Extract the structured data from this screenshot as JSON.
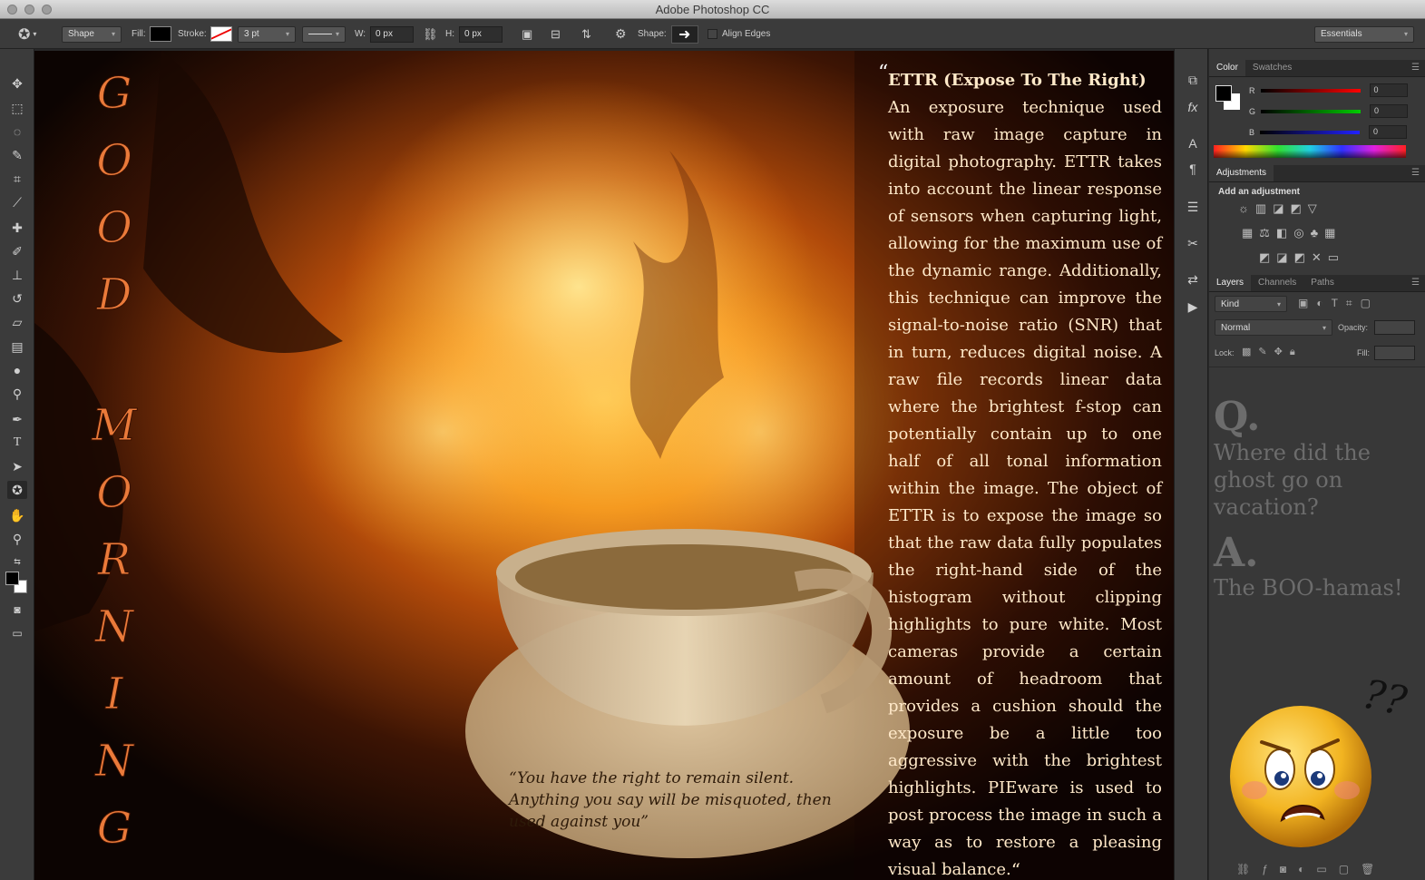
{
  "app": {
    "title": "Adobe Photoshop CC"
  },
  "options_bar": {
    "mode": "Shape",
    "fill_label": "Fill:",
    "stroke_label": "Stroke:",
    "stroke_width": "3 pt",
    "w_label": "W:",
    "w_value": "0 px",
    "h_label": "H:",
    "h_value": "0 px",
    "shape_label": "Shape:",
    "align_edges_label": "Align Edges",
    "workspace": "Essentials"
  },
  "canvas": {
    "vertical_text": [
      "G",
      "O",
      "O",
      "D",
      " ",
      "M",
      "O",
      "R",
      "N",
      "I",
      "N",
      "G"
    ],
    "article_title": "ETTR (Expose To The Right)",
    "article_body": "An exposure technique used with raw image capture in digital photography. ETTR takes into account the linear response of sensors when capturing light, allowing for the maximum use of the dynamic range. Additionally, this technique can improve the signal-to-noise ratio (SNR) that in turn, reduces digital noise. A raw file records linear data where the brightest f-stop can potentially contain up to one half of all tonal information within the image. The object of ETTR is to expose the image so that the raw data fully populates the right-hand side of the histogram without clipping highlights to pure white. Most cameras provide a certain amount of headroom that provides a cushion should the exposure be a little too aggressive with the brightest highlights. PIEware is used to post process the image in such a way as to restore a pleasing visual balance.",
    "open_quote": "“",
    "close_quote": "“",
    "cup_quote": "“You have the right to remain silent. Anything you say will be misquoted, then used against you”"
  },
  "color_panel": {
    "tabs": [
      "Color",
      "Swatches"
    ],
    "r_label": "R",
    "g_label": "G",
    "b_label": "B",
    "r_value": "0",
    "g_value": "0",
    "b_value": "0"
  },
  "adjustments_panel": {
    "tab": "Adjustments",
    "heading": "Add an adjustment"
  },
  "layers_panel": {
    "tabs": [
      "Layers",
      "Channels",
      "Paths"
    ],
    "kind_filter": "Kind",
    "blend_mode": "Normal",
    "opacity_label": "Opacity:",
    "lock_label": "Lock:",
    "fill_label": "Fill:"
  },
  "joke": {
    "q_letter": "Q.",
    "question": "Where did the ghost go on vacation?",
    "a_letter": "A.",
    "answer": "The BOO-hamas!",
    "marks": "??"
  }
}
